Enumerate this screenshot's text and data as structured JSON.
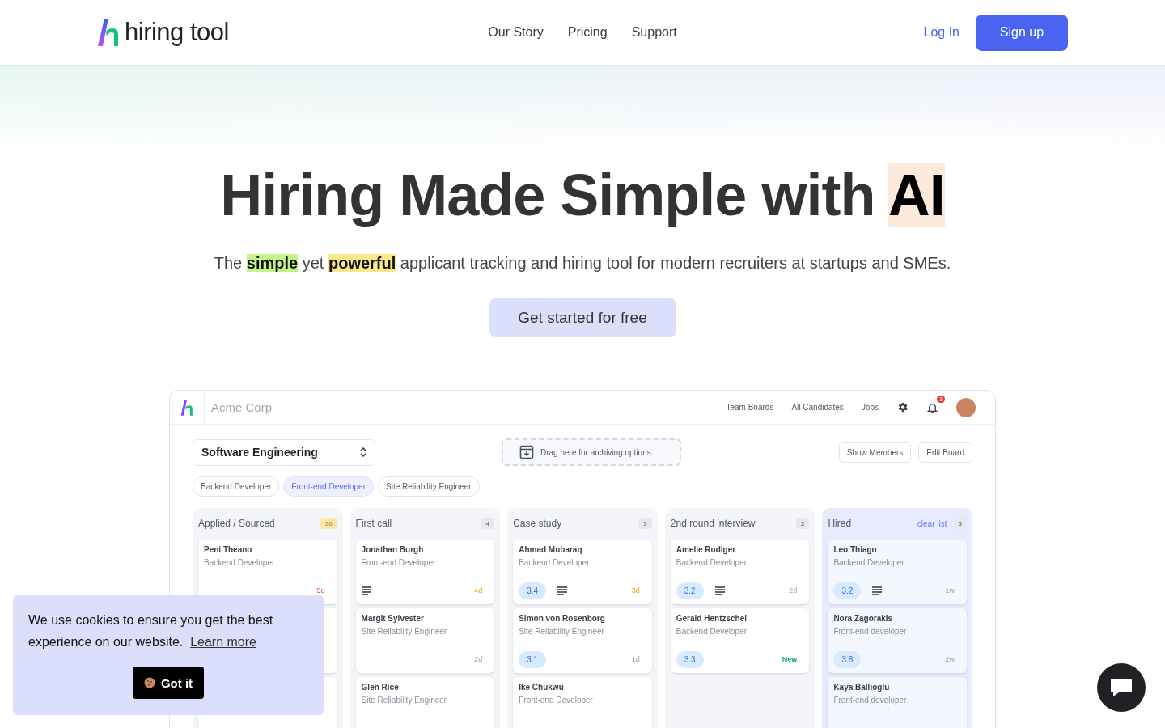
{
  "header": {
    "logo": "hiring tool",
    "nav": [
      {
        "label": "Our Story"
      },
      {
        "label": "Pricing"
      },
      {
        "label": "Support"
      }
    ],
    "login": "Log In",
    "signup": "Sign up"
  },
  "hero": {
    "title": "Hiring Made Simple with",
    "title_highlight": "AI",
    "subtitle": "The **simple** yet **powerful** applicant tracking and hiring tool for modern recruiters at startups and SMEs.",
    "cta": "Get started for free"
  },
  "app": {
    "company": "Acme Corp",
    "nav": [
      {
        "label": "Team Boards"
      },
      {
        "label": "All Candidates"
      },
      {
        "label": "Jobs"
      }
    ],
    "notification_count": "3",
    "board_select": "Software Engineering",
    "archive_drop": "Drag here for archiving options",
    "actions": [
      "Show Members",
      "Edit Board"
    ],
    "job_filters": [
      {
        "label": "Backend Developer",
        "selected": false
      },
      {
        "label": "Front-end Developer",
        "selected": true
      },
      {
        "label": "Site Reliability Engineer",
        "selected": false
      }
    ],
    "columns": [
      {
        "title": "Applied / Sourced",
        "count": "26",
        "count_highlight": true,
        "tinted": false,
        "cards": [
          {
            "name": "Peni Theano",
            "role": "Backend Developer",
            "has_notes": false,
            "age": {
              "text": "5d",
              "kind": "overdue"
            }
          },
          {
            "has_notes": false
          },
          {
            "has_notes": false
          }
        ]
      },
      {
        "title": "First call",
        "count": "4",
        "count_highlight": false,
        "tinted": false,
        "cards": [
          {
            "name": "Jonathan Burgh",
            "role": "Front-end Developer",
            "has_notes": true,
            "age": {
              "text": "4d",
              "kind": "due"
            }
          },
          {
            "name": "Margit Sylvester",
            "role": "Site Reliability Engineer",
            "has_notes": false,
            "age": {
              "text": "2d",
              "kind": "normal"
            }
          },
          {
            "name": "Glen Rice",
            "role": "Site Reliability Engineer",
            "has_notes": false
          }
        ]
      },
      {
        "title": "Case study",
        "count": "3",
        "count_highlight": false,
        "tinted": false,
        "cards": [
          {
            "name": "Ahmad Mubaraq",
            "role": "Backend Developer",
            "rating": "3.4",
            "has_notes": true,
            "age": {
              "text": "3d",
              "kind": "due"
            }
          },
          {
            "name": "Simon von Rosenborg",
            "role": "Site Reliability Engineer",
            "rating": "3.1",
            "has_notes": false,
            "age": {
              "text": "1d",
              "kind": "normal"
            }
          },
          {
            "name": "Ike Chukwu",
            "role": "Front-end Developer",
            "has_notes": false
          }
        ]
      },
      {
        "title": "2nd round interview",
        "count": "2",
        "count_highlight": false,
        "tinted": false,
        "cards": [
          {
            "name": "Amelie Rudiger",
            "role": "Backend Developer",
            "rating": "3.2",
            "has_notes": true,
            "age": {
              "text": "2d",
              "kind": "normal"
            }
          },
          {
            "name": "Gerald Hentzschel",
            "role": "Backend Developer",
            "rating": "3.3",
            "has_notes": false,
            "age": {
              "text": "New",
              "kind": "new"
            }
          }
        ]
      },
      {
        "title": "Hired",
        "link": "clear list",
        "count": "3",
        "count_highlight": false,
        "tinted": true,
        "cards": [
          {
            "name": "Leo Thiago",
            "role": "Backend Developer",
            "rating": "3.2",
            "has_notes": true,
            "age": {
              "text": "1w",
              "kind": "normal"
            }
          },
          {
            "name": "Nora Zagorakis",
            "role": "Front-end developer",
            "rating": "3.8",
            "has_notes": false,
            "age": {
              "text": "2w",
              "kind": "normal"
            }
          },
          {
            "name": "Kaya Ballioglu",
            "role": "Front-end developer",
            "has_notes": false
          }
        ]
      }
    ]
  },
  "cookie_banner": {
    "message": "We use cookies to ensure you get the best experience on our website.",
    "link": "Learn more",
    "button": "Got it"
  }
}
